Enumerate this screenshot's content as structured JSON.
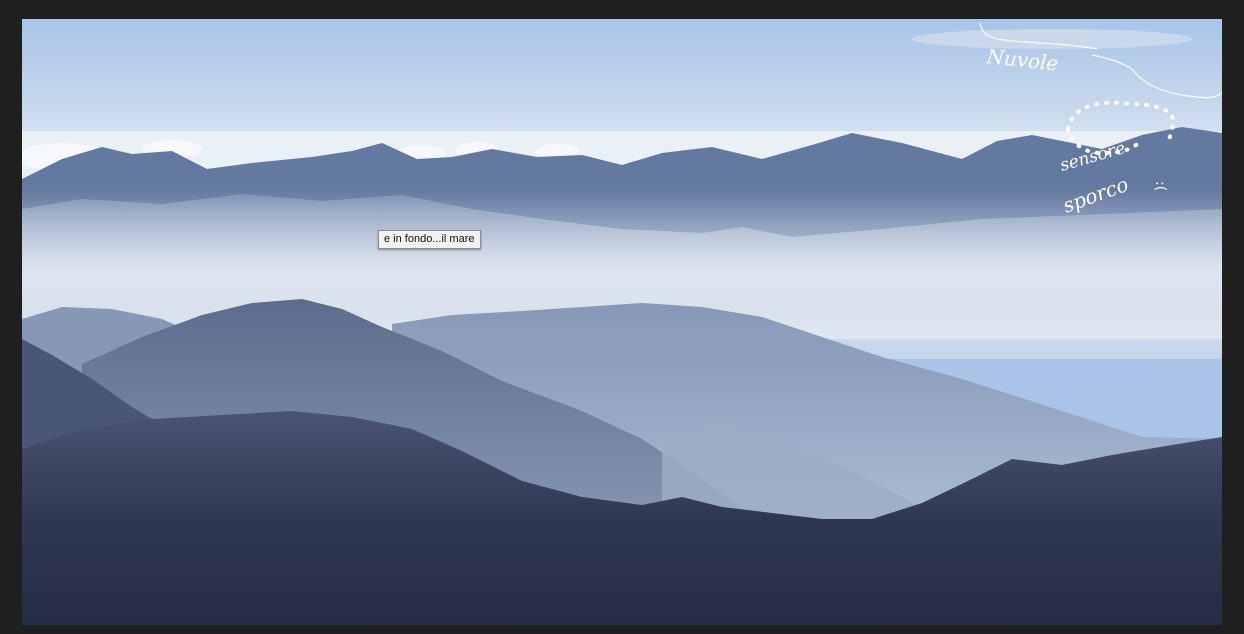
{
  "viewer": {
    "background": "#1f1f1f"
  },
  "photo": {
    "subject": "layered misty mountain ridges under a pale blue sky",
    "hover_tooltip": "e in fondo...il mare",
    "annotations": {
      "clouds_note": "Nuvole",
      "sad_note_line1": "sensore",
      "sad_note_line2": "sporco",
      "sad_face": ":("
    }
  },
  "colors": {
    "sky_top": "#a9c4e6",
    "sky_horizon": "#e6eef6",
    "far_ridge": "#5d7094",
    "mid_ridge": "#8ea0bd",
    "foreground": "#2d3550",
    "annotation_ink": "#ffffff"
  }
}
